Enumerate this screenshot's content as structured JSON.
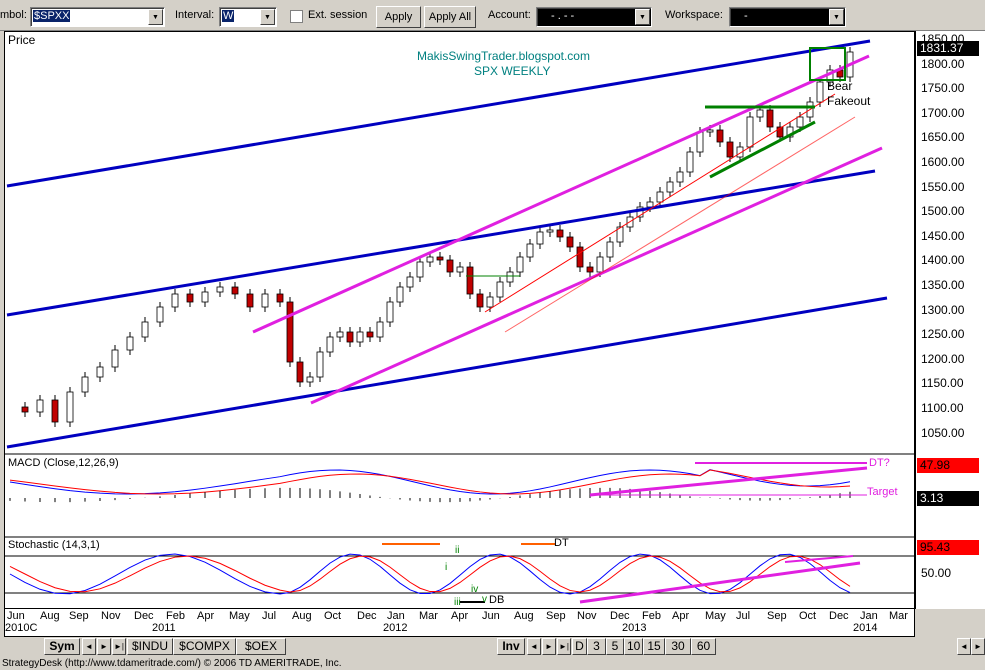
{
  "toolbar": {
    "symbol_label": "mbol:",
    "symbol_value": "$SPXX",
    "interval_label": "Interval:",
    "interval_value": "W",
    "ext_session_label": "Ext. session",
    "apply_label": "Apply",
    "apply_all_label": "Apply All",
    "account_label": "Account:",
    "account_value": "-   .   -   -",
    "workspace_label": "Workspace:",
    "workspace_value": "-"
  },
  "price_panel": {
    "title": "Price",
    "watermark_line1": "MakisSwingTrader.blogspot.com",
    "watermark_line2": "SPX WEEKLY",
    "current_price": "1831.37",
    "annotation_line1": "Bear",
    "annotation_line2": "Fakeout",
    "y_ticks": [
      "1850.00",
      "1800.00",
      "1750.00",
      "1700.00",
      "1650.00",
      "1600.00",
      "1550.00",
      "1500.00",
      "1450.00",
      "1400.00",
      "1350.00",
      "1300.00",
      "1250.00",
      "1200.00",
      "1150.00",
      "1100.00",
      "1050.00"
    ]
  },
  "macd_panel": {
    "title": "MACD (Close,12,26,9)",
    "value_top": "47.98",
    "value_bottom": "3.13",
    "label_dt": "DT?",
    "label_target": "Target"
  },
  "stoch_panel": {
    "title": "Stochastic (14,3,1)",
    "value": "95.43",
    "level": "50.00",
    "label_dt": "DT",
    "label_db": "DB",
    "label_iii": "iii",
    "label_ii": "ii",
    "label_i": "i",
    "label_iv": "iv",
    "label_v": "v"
  },
  "x_axis": {
    "months": [
      "Jun",
      "Aug",
      "Sep",
      "Nov",
      "Dec",
      "Feb",
      "Apr",
      "May",
      "Jul",
      "Aug",
      "Oct",
      "Dec",
      "Jan",
      "Mar",
      "Apr",
      "Jun",
      "Aug",
      "Sep",
      "Nov",
      "Dec",
      "Feb",
      "Apr",
      "May",
      "Jul",
      "Sep",
      "Oct",
      "Dec",
      "Jan",
      "Mar"
    ],
    "years": [
      "2010C",
      "2011",
      "2012",
      "2013",
      "2014"
    ]
  },
  "bottom_bar": {
    "sym_tab": "Sym",
    "tabs": [
      "$INDU",
      "$COMPX",
      "$OEX"
    ],
    "inv_tab": "Inv",
    "intervals": [
      "D",
      "3",
      "5",
      "10",
      "15",
      "30",
      "60"
    ]
  },
  "status_text": "StrategyDesk (http://www.tdameritrade.com/) © 2006 TD AMERITRADE, Inc.",
  "colors": {
    "channel_blue": "#0000c0",
    "channel_magenta": "#e020e0",
    "bull_candle": "#ffffff",
    "bear_candle": "#c00000",
    "trend_green": "#008000",
    "value_red": "#ff0000"
  }
}
